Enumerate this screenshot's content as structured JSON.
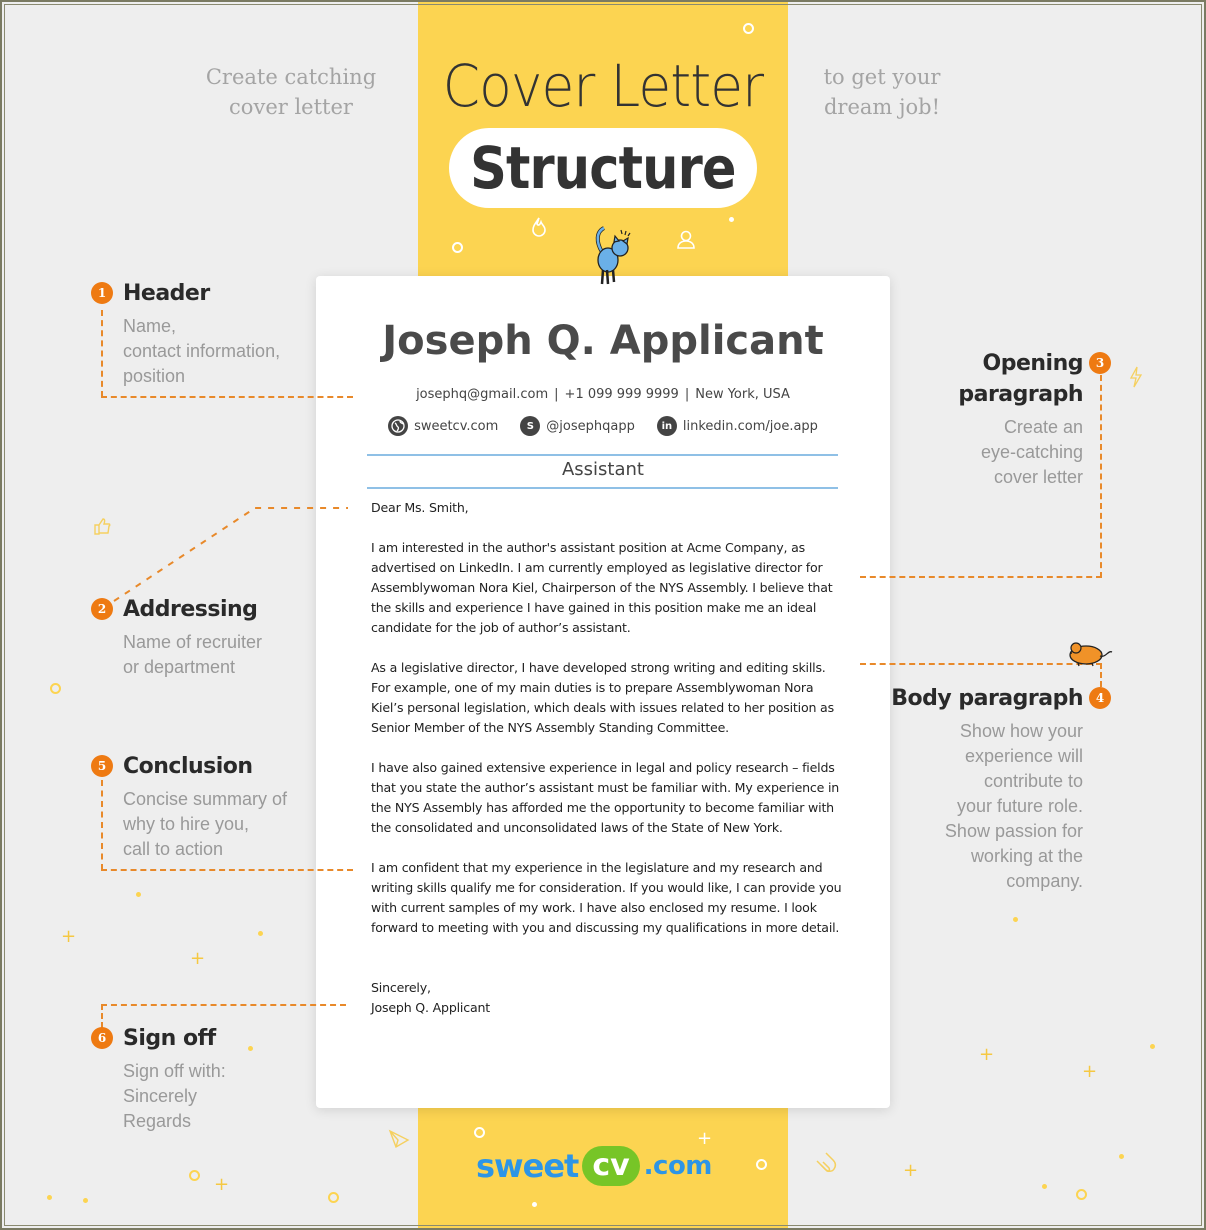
{
  "header": {
    "tagline_left": [
      "Create catching",
      "cover letter"
    ],
    "tagline_right": [
      "to get your",
      "dream job!"
    ],
    "title_line1": "Cover Letter",
    "title_line2": "Structure"
  },
  "colors": {
    "band": "#fcd451",
    "background": "#eeeeee",
    "badge": "#ee7a12",
    "connector": "#e8892a",
    "rule": "#8fc0e6",
    "logo_blue": "#2d95e6",
    "logo_green": "#77c527"
  },
  "letter": {
    "name": "Joseph Q. Applicant",
    "email": "josephq@gmail.com",
    "phone": "+1 099 999 9999",
    "location": "New York, USA",
    "separator": "|",
    "social": [
      {
        "icon": "globe-icon",
        "glyph": "🌐",
        "label": "sweetcv.com"
      },
      {
        "icon": "skype-icon",
        "glyph": "S",
        "label": "@josephqapp"
      },
      {
        "icon": "linkedin-icon",
        "glyph": "in",
        "label": "linkedin.com/joe.app"
      }
    ],
    "position": "Assistant",
    "salutation": "Dear Ms. Smith,",
    "paragraphs": [
      "I am interested in the author's assistant position at Acme Company, as advertised on LinkedIn. I am currently employed as legislative director for Assemblywoman Nora Kiel, Chairperson of the NYS Assembly. I believe that the skills and experience I have gained in this position make me an ideal candidate for the job of author’s assistant.",
      "As a legislative director, I have developed strong writing and editing skills. For example, one of my main duties is to prepare Assemblywoman Nora Kiel’s personal legislation, which deals with issues related to her position as Senior Member of the NYS Assembly Standing Committee.",
      "I have also gained extensive experience in legal and policy research – fields that you state the author’s assistant must be familiar with. My experience in the NYS Assembly has afforded me the opportunity to become familiar with the consolidated and unconsolidated laws of the State of New York.",
      "I am confident that my experience in the legislature and my research and writing skills qualify me for consideration. If you would like, I can provide you with current samples of my work. I have also enclosed my resume. I look forward to meeting with you and discussing my qualifications in more detail."
    ],
    "closing": "Sincerely,",
    "signature": "Joseph Q. Applicant"
  },
  "callouts": [
    {
      "number": "1",
      "title": "Header",
      "desc": [
        "Name,",
        "contact information,",
        "position"
      ]
    },
    {
      "number": "2",
      "title": "Addressing",
      "desc": [
        "Name of recruiter",
        "or department"
      ]
    },
    {
      "number": "3",
      "title": [
        "Opening",
        "paragraph"
      ],
      "desc": [
        "Create an",
        "eye-catching",
        "cover letter"
      ]
    },
    {
      "number": "4",
      "title": "Body paragraph",
      "desc": [
        "Show how your",
        "experience will",
        "contribute to",
        "your future role.",
        "Show passion for",
        "working at the",
        "company."
      ]
    },
    {
      "number": "5",
      "title": "Conclusion",
      "desc": [
        "Concise summary of",
        "why to hire you,",
        "call to action"
      ]
    },
    {
      "number": "6",
      "title": "Sign off",
      "desc": [
        "Sign off with:",
        "Sincerely",
        "Regards"
      ]
    }
  ],
  "logo": {
    "part1": "sweet",
    "part2": "cv",
    "part3": ".com"
  }
}
